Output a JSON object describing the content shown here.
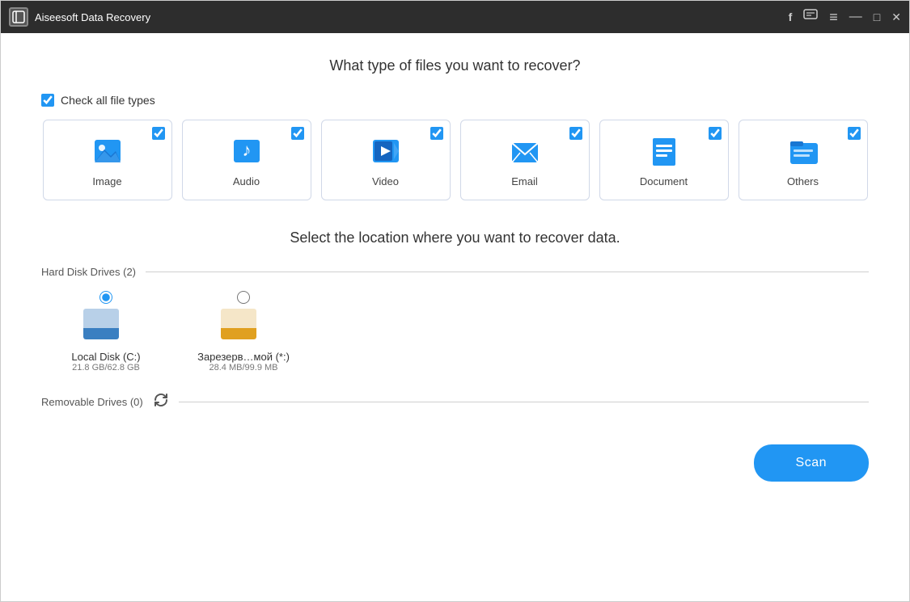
{
  "titlebar": {
    "icon": "⊞",
    "title": "Aiseesoft Data Recovery",
    "controls": {
      "facebook": "f",
      "chat": "💬",
      "menu": "≡",
      "minimize": "—",
      "maximize": "□",
      "close": "✕"
    }
  },
  "main": {
    "file_type_question": "What type of files you want to recover?",
    "check_all_label": "Check all file types",
    "check_all_checked": true,
    "file_types": [
      {
        "id": "image",
        "label": "Image",
        "checked": true,
        "icon": "image"
      },
      {
        "id": "audio",
        "label": "Audio",
        "checked": true,
        "icon": "audio"
      },
      {
        "id": "video",
        "label": "Video",
        "checked": true,
        "icon": "video"
      },
      {
        "id": "email",
        "label": "Email",
        "checked": true,
        "icon": "email"
      },
      {
        "id": "document",
        "label": "Document",
        "checked": true,
        "icon": "document"
      },
      {
        "id": "others",
        "label": "Others",
        "checked": true,
        "icon": "others"
      }
    ],
    "location_question": "Select the location where you want to recover data.",
    "hard_disk_drives_label": "Hard Disk Drives (2)",
    "drives": [
      {
        "id": "c",
        "name": "Local Disk (C:)",
        "size": "21.8 GB/62.8 GB",
        "selected": true,
        "type": "c"
      },
      {
        "id": "reserved",
        "name": "Зарезерв…мой (*:)",
        "size": "28.4 MB/99.9 MB",
        "selected": false,
        "type": "reserved"
      }
    ],
    "removable_drives_label": "Removable Drives (0)",
    "scan_button_label": "Scan"
  }
}
